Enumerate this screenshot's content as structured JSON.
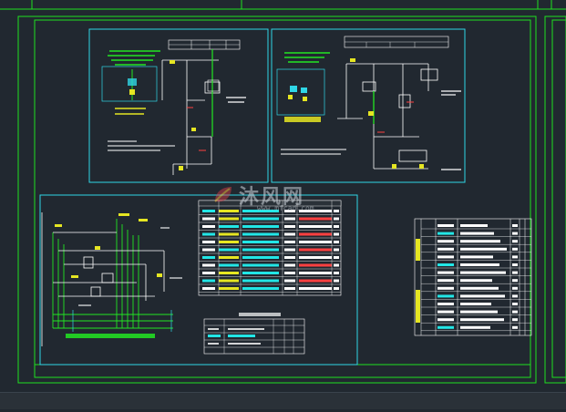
{
  "colors": {
    "background": "#212830",
    "frame": "#1fe01f",
    "panel_border": "#2fd6e6",
    "wire": "#ffffff",
    "green_text": "#22e622",
    "cyan_text": "#22e6e6",
    "yellow": "#e6e622",
    "red": "#ff4040",
    "magenta": "#e040e0"
  },
  "watermark": {
    "logo_icon": "leaf-logo-icon",
    "text": "沐风网",
    "url": "www.mfcad.com"
  }
}
